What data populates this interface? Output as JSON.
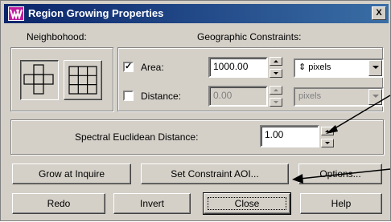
{
  "window": {
    "title": "Region Growing Properties",
    "close_label": "X"
  },
  "neighborhood": {
    "label": "Neighbohood:"
  },
  "constraints": {
    "label": "Geographic Constraints:",
    "area": {
      "checked": true,
      "check_mark": "✓",
      "label": "Area:",
      "value": "1000.00",
      "unit": "pixels",
      "unit_icon": "⇕"
    },
    "distance": {
      "checked": false,
      "label": "Distance:",
      "value": "0.00",
      "unit": "pixels"
    }
  },
  "spectral": {
    "label": "Spectral Euclidean Distance:",
    "value": "1.00"
  },
  "buttons": {
    "grow_at_inquire": "Grow at Inquire",
    "set_constraint_aoi": "Set Constraint AOI...",
    "options": "Options...",
    "redo": "Redo",
    "invert": "Invert",
    "close": "Close",
    "help": "Help"
  }
}
